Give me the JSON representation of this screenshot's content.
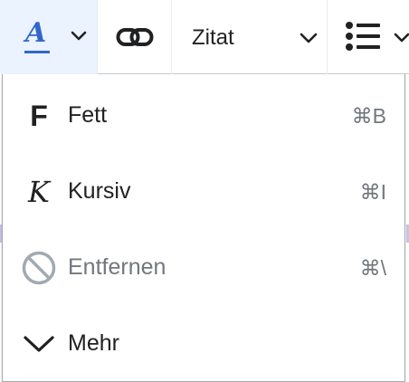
{
  "toolbar": {
    "style_button": {
      "letter": "A",
      "icon": "text-style-icon",
      "accent": "#3366cc"
    },
    "link_button": {
      "icon": "link-icon"
    },
    "format_select": {
      "value": "Zitat"
    },
    "list_button": {
      "icon": "bullet-list-icon"
    }
  },
  "menu": {
    "items": [
      {
        "icon_text": "F",
        "icon": "bold-icon",
        "label": "Fett",
        "shortcut": "⌘B",
        "enabled": true
      },
      {
        "icon_text": "K",
        "icon": "italic-icon",
        "label": "Kursiv",
        "shortcut": "⌘I",
        "enabled": true
      },
      {
        "icon_text": "",
        "icon": "clear-format-icon",
        "label": "Entfernen",
        "shortcut": "⌘\\",
        "enabled": false
      },
      {
        "icon_text": "",
        "icon": "chevron-down-icon",
        "label": "Mehr",
        "shortcut": "",
        "enabled": true
      }
    ]
  },
  "colors": {
    "accent": "#3366cc",
    "active_bg": "#eaf3ff",
    "text": "#202122",
    "muted": "#72777d",
    "border": "#a2a9b1"
  }
}
